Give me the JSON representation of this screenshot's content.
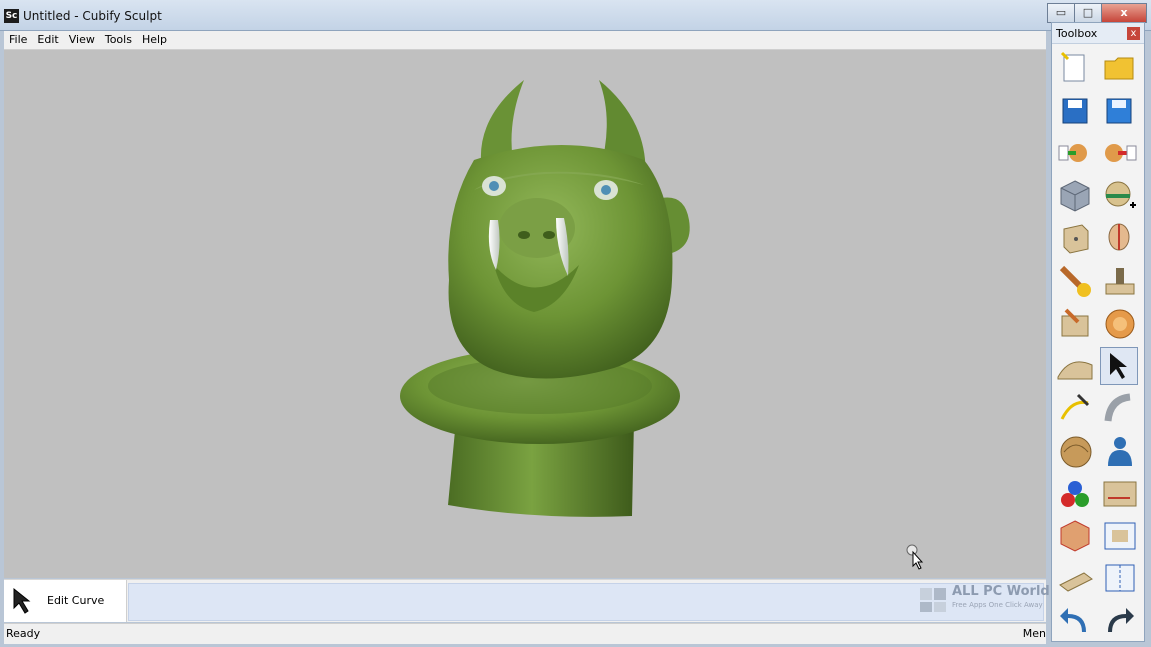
{
  "window": {
    "app_icon_text": "Sc",
    "title": "Untitled - Cubify Sculpt",
    "minimize": "▭",
    "maximize": "□",
    "close": "x"
  },
  "menu": {
    "items": [
      "File",
      "Edit",
      "View",
      "Tools",
      "Help"
    ]
  },
  "toolbox": {
    "title": "Toolbox",
    "close": "x",
    "tools": [
      "new-file-icon",
      "open-folder-icon",
      "save-icon",
      "save-as-icon",
      "import-icon",
      "export-icon",
      "cube-icon",
      "add-sphere-icon",
      "box-icon",
      "head-icon",
      "sculpt-brush-icon",
      "stamp-icon",
      "carve-box-icon",
      "smooth-icon",
      "terrain-icon",
      "select-arrow-icon",
      "draw-curve-icon",
      "bend-icon",
      "mesh-icon",
      "figure-icon",
      "materials-icon",
      "measure-icon",
      "render-box-icon",
      "fit-view-icon",
      "plane-icon",
      "mirror-icon",
      "undo-icon",
      "redo-icon"
    ],
    "active_tool": "select-arrow-icon"
  },
  "bottom_panel": {
    "current_tool_label": "Edit Curve"
  },
  "status": {
    "left": "Ready",
    "right": "Men"
  },
  "watermark": {
    "title": "ALL PC World",
    "subtitle": "Free Apps One Click Away"
  },
  "colors": {
    "viewport_bg": "#c0c0c0",
    "model_green": "#6f9a3a",
    "title_bar": "#cfdcec"
  }
}
